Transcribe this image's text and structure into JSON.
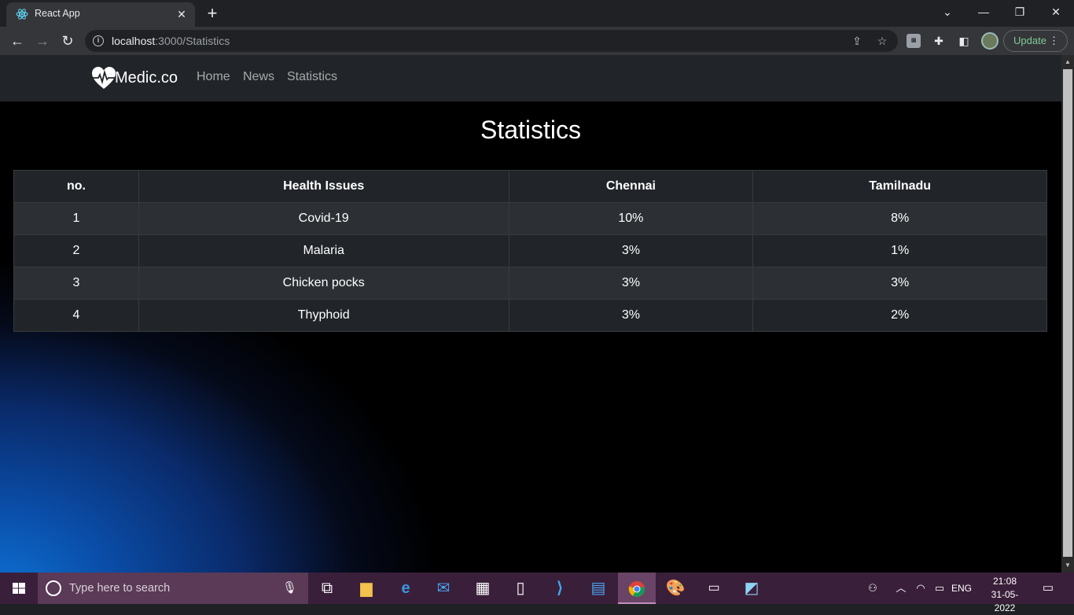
{
  "browser": {
    "tab_title": "React App",
    "tab_close": "✕",
    "new_tab": "+",
    "url_host": "localhost",
    "url_path": ":3000/Statistics",
    "update_label": "Update"
  },
  "site": {
    "brand": "Medic.co",
    "nav": [
      "Home",
      "News",
      "Statistics"
    ]
  },
  "main": {
    "heading": "Statistics",
    "table": {
      "headers": [
        "no.",
        "Health Issues",
        "Chennai",
        "Tamilnadu"
      ],
      "rows": [
        [
          "1",
          "Covid-19",
          "10%",
          "8%"
        ],
        [
          "2",
          "Malaria",
          "3%",
          "1%"
        ],
        [
          "3",
          "Chicken pocks",
          "3%",
          "3%"
        ],
        [
          "4",
          "Thyphoid",
          "3%",
          "2%"
        ]
      ]
    }
  },
  "taskbar": {
    "search_placeholder": "Type here to search",
    "language": "ENG",
    "time": "21:08",
    "date": "31-05-2022"
  },
  "colors": {
    "navbar_bg": "#212529",
    "nav_link": "rgba(255,255,255,0.6)",
    "update_text": "#81c995",
    "taskbar_bg": "#3a1f3a"
  }
}
